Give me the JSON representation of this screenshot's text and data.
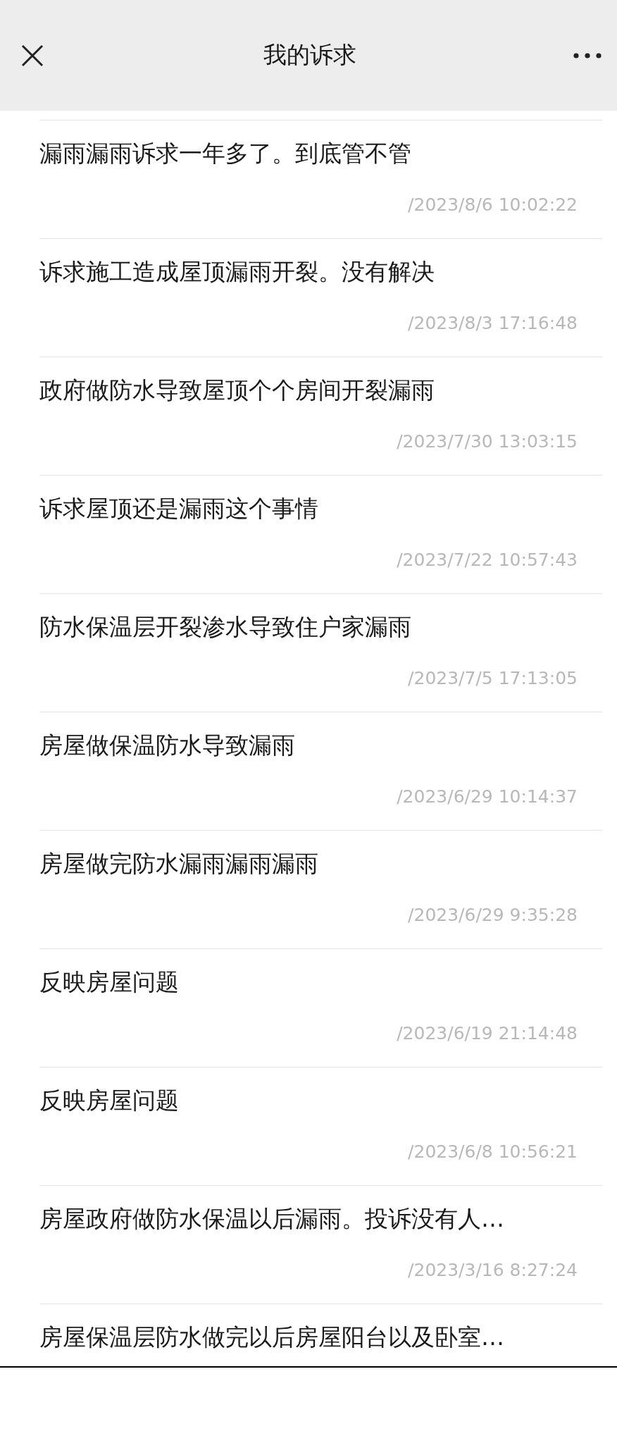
{
  "header": {
    "title": "我的诉求"
  },
  "items": [
    {
      "title": "漏雨漏雨诉求一年多了。到底管不管",
      "time": "/2023/8/6 10:02:22"
    },
    {
      "title": "诉求施工造成屋顶漏雨开裂。没有解决",
      "time": "/2023/8/3 17:16:48"
    },
    {
      "title": "政府做防水导致屋顶个个房间开裂漏雨",
      "time": "/2023/7/30 13:03:15"
    },
    {
      "title": "诉求屋顶还是漏雨这个事情",
      "time": "/2023/7/22 10:57:43"
    },
    {
      "title": "防水保温层开裂渗水导致住户家漏雨",
      "time": "/2023/7/5 17:13:05"
    },
    {
      "title": "房屋做保温防水导致漏雨",
      "time": "/2023/6/29 10:14:37"
    },
    {
      "title": "房屋做完防水漏雨漏雨漏雨",
      "time": "/2023/6/29 9:35:28"
    },
    {
      "title": "反映房屋问题",
      "time": "/2023/6/19 21:14:48"
    },
    {
      "title": "反映房屋问题",
      "time": "/2023/6/8 10:56:21"
    },
    {
      "title": "房屋政府做防水保温以后漏雨。投诉没有人…",
      "time": "/2023/3/16 8:27:24"
    },
    {
      "title": "房屋保温层防水做完以后房屋阳台以及卧室…"
    }
  ]
}
